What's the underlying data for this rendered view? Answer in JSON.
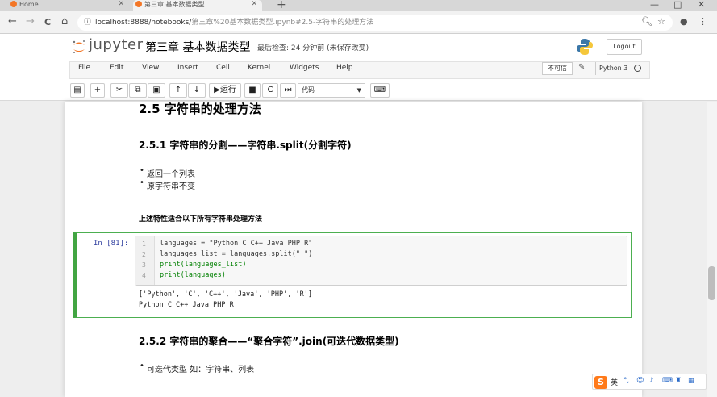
{
  "browser": {
    "tabs": [
      {
        "label": "Home",
        "active": false
      },
      {
        "label": "第三章 基本数据类型",
        "active": true
      }
    ],
    "new_tab": "+",
    "window_controls": [
      "—",
      "□",
      "✕"
    ],
    "nav": {
      "back": "←",
      "forward": "→",
      "reload": "C",
      "home": "⌂"
    },
    "url_host": "localhost:8888/notebooks/",
    "url_path": "第三章%20基本数据类型.ipynb#2.5-字符串的处理方法",
    "right_icons": [
      "zoom-icon",
      "star-icon",
      "profile-icon",
      "menu-icon"
    ]
  },
  "jupyter": {
    "logo_text": "jupyter",
    "notebook_name": "第三章 基本数据类型",
    "save_status": "最后检查: 24 分钟前 (未保存改变)",
    "logout_label": "Logout",
    "menu": [
      "File",
      "Edit",
      "View",
      "Insert",
      "Cell",
      "Kernel",
      "Widgets",
      "Help"
    ],
    "trusted_label": "不可信",
    "kernel_name": "Python 3",
    "run_label": "运行",
    "cell_type": "代码",
    "accent": "#f37626"
  },
  "content": {
    "heading_main": "2.5 字符串的处理方法",
    "heading_split": "2.5.1 字符串的分割——字符串.split(分割字符)",
    "bullets_split": [
      "返回一个列表",
      "原字符串不变"
    ],
    "note": "上述特性适合以下所有字符串处理方法",
    "prompt": "In  [81]:",
    "line_numbers": [
      "1",
      "2",
      "3",
      "4"
    ],
    "code_lines": [
      "languages = \"Python C C++ Java PHP R\"",
      "languages_list = languages.split(\" \")",
      "print(languages_list)",
      "print(languages)"
    ],
    "output_lines": [
      "['Python', 'C', 'C++', 'Java', 'PHP', 'R']",
      "Python C C++ Java PHP R"
    ],
    "heading_join": "2.5.2 字符串的聚合——“聚合字符”.join(可迭代数据类型)",
    "bullets_join": [
      "可迭代类型 如：字符串、列表"
    ]
  },
  "ime": {
    "logo": "S",
    "mode": "英"
  }
}
